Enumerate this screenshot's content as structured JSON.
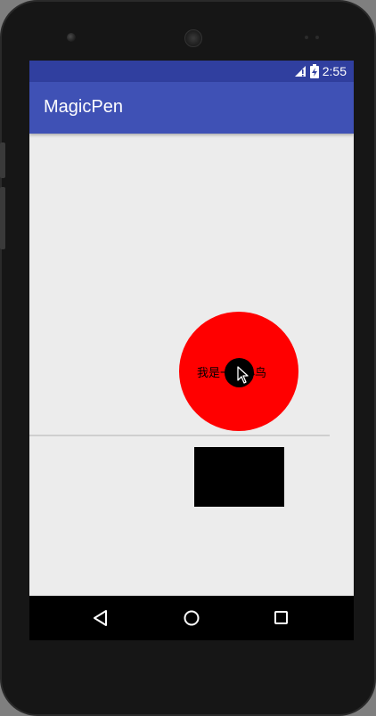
{
  "status_bar": {
    "time": "2:55",
    "icons": [
      "signal-icon",
      "battery-charging-icon"
    ]
  },
  "app_bar": {
    "title": "MagicPen"
  },
  "canvas": {
    "circle_color": "#ff0000",
    "circle_text": "我是一只小鸟",
    "dot_color": "#000000",
    "rect_color": "#000000"
  },
  "nav_bar": {
    "buttons": [
      "back-icon",
      "home-icon",
      "recents-icon"
    ]
  },
  "colors": {
    "status_bar": "#303f9f",
    "app_bar": "#3f51b5",
    "background": "#ececec"
  }
}
